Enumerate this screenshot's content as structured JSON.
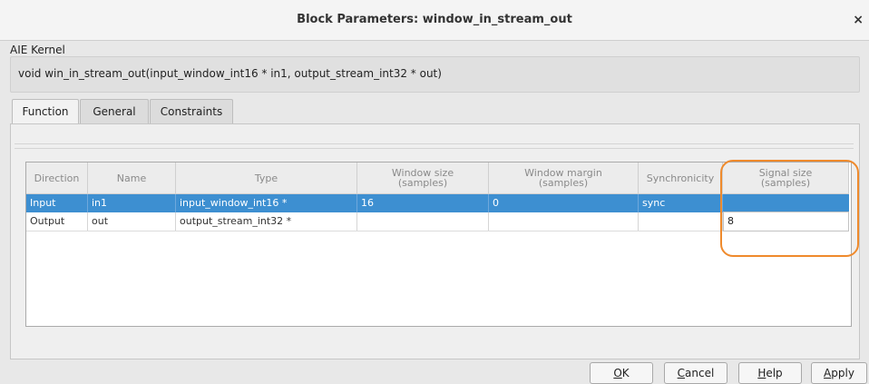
{
  "window": {
    "title": "Block Parameters: window_in_stream_out",
    "close_glyph": "×"
  },
  "section_label": "AIE Kernel",
  "function_signature": "void win_in_stream_out(input_window_int16 * in1, output_stream_int32 * out)",
  "tabs": [
    {
      "label": "Function",
      "active": true
    },
    {
      "label": "General",
      "active": false
    },
    {
      "label": "Constraints",
      "active": false
    }
  ],
  "table": {
    "headers": [
      {
        "line1": "Direction",
        "line2": ""
      },
      {
        "line1": "Name",
        "line2": ""
      },
      {
        "line1": "Type",
        "line2": ""
      },
      {
        "line1": "Window size",
        "line2": "(samples)"
      },
      {
        "line1": "Window margin",
        "line2": "(samples)"
      },
      {
        "line1": "Synchronicity",
        "line2": ""
      },
      {
        "line1": "Signal size",
        "line2": "(samples)"
      }
    ],
    "rows": [
      {
        "selected": true,
        "cells": [
          "Input",
          "in1",
          "input_window_int16 *",
          "16",
          "0",
          "sync",
          ""
        ]
      },
      {
        "selected": false,
        "cells": [
          "Output",
          "out",
          "output_stream_int32 *",
          "",
          "",
          "",
          "8"
        ]
      }
    ]
  },
  "buttons": {
    "ok": {
      "mnemonic": "O",
      "rest": "K"
    },
    "cancel": {
      "mnemonic": "C",
      "rest": "ancel"
    },
    "help": {
      "mnemonic": "H",
      "rest": "elp"
    },
    "apply": {
      "mnemonic": "A",
      "rest": "pply"
    }
  },
  "colors": {
    "selection": "#3d8fd1",
    "highlight_annotation": "#ef8a2c"
  }
}
